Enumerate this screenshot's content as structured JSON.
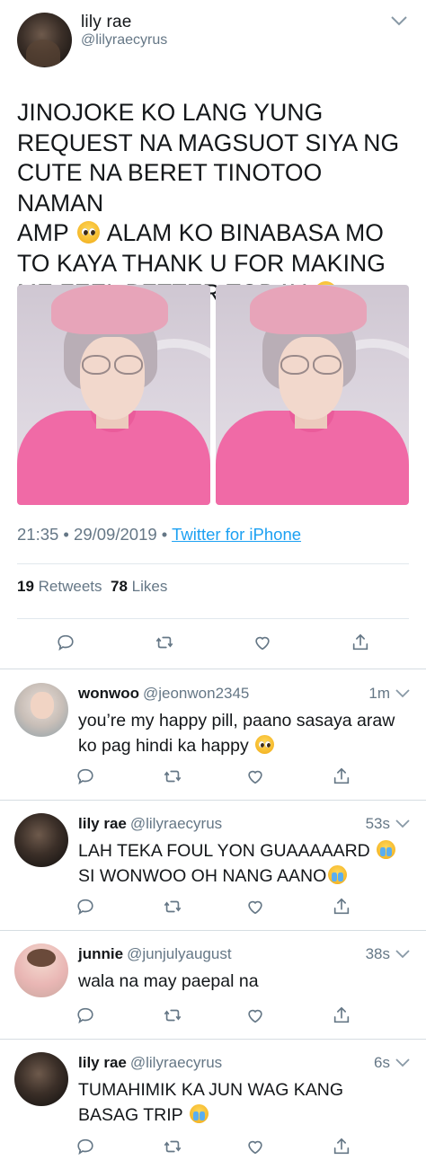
{
  "main_tweet": {
    "author_name": "lily rae",
    "author_handle": "@lilyraecyrus",
    "text_lines": [
      "JINOJOKE KO LANG YUNG",
      "REQUEST NA MAGSUOT SIYA NG",
      "CUTE NA BERET TINOTOO NAMAN",
      "AMP",
      "ALAM KO BINABASA MO",
      "TO KAYA THANK U FOR MAKING",
      "ME FEEL BETTER TODAY"
    ],
    "timestamp": "21:35 • 29/09/2019 •",
    "source": "Twitter for iPhone",
    "retweet_count": "19",
    "retweet_label": "Retweets",
    "like_count": "78",
    "like_label": "Likes"
  },
  "replies": [
    {
      "name": "wonwoo",
      "handle": "@jeonwon2345",
      "time": "1m",
      "lines": [
        "you’re my happy pill, paano sasaya araw",
        "ko pag hindi ka happy"
      ]
    },
    {
      "name": "lily rae",
      "handle": "@lilyraecyrus",
      "time": "53s",
      "lines": [
        "LAH TEKA FOUL YON GUAAAAARD",
        "SI WONWOO OH NANG AANO"
      ]
    },
    {
      "name": "junnie",
      "handle": "@junjulyaugust",
      "time": "38s",
      "lines": [
        "wala na may paepal na"
      ]
    },
    {
      "name": "lily rae",
      "handle": "@lilyraecyrus",
      "time": "6s",
      "lines": [
        "TUMAHIMIK KA JUN WAG KANG",
        "BASAG TRIP"
      ]
    }
  ],
  "icons": {
    "reply": "reply-icon",
    "retweet": "retweet-icon",
    "like": "like-icon",
    "share": "share-icon",
    "caret": "chevron-down-icon"
  },
  "colors": {
    "text": "#14171a",
    "secondary": "#657786",
    "link": "#1da1f2",
    "divider": "#e1e8ed"
  }
}
